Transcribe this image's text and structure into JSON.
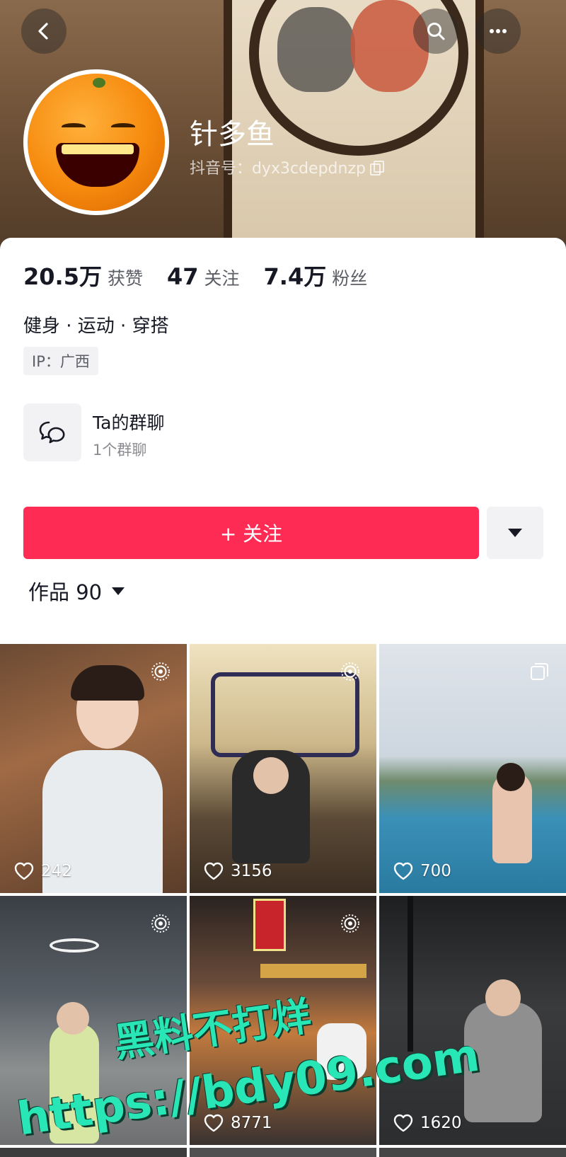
{
  "profile": {
    "name": "针多鱼",
    "douyin_id": "抖音号：dyx3cdepdnzp"
  },
  "stats": [
    {
      "value": "20.5万",
      "label": "获赞"
    },
    {
      "value": "47",
      "label": "关注"
    },
    {
      "value": "7.4万",
      "label": "粉丝"
    }
  ],
  "bio": "健身 · 运动 · 穿搭",
  "ip_location": "IP：广西",
  "group_chat": {
    "title": "Ta的群聊",
    "subtitle": "1个群聊"
  },
  "actions": {
    "follow_label": "+ 关注"
  },
  "works_tab": {
    "label": "作品 90"
  },
  "videos": [
    {
      "likes": "242"
    },
    {
      "likes": "3156"
    },
    {
      "likes": "700"
    },
    {
      "likes": ""
    },
    {
      "likes": "8771"
    },
    {
      "likes": "1620"
    }
  ],
  "watermark": {
    "line1": "黑料不打烊",
    "line2": "https://bdy09.com"
  },
  "colors": {
    "accent": "#fe2c55",
    "watermark": "#29e6b6"
  },
  "icons": {
    "back": "chevron-left-icon",
    "search": "search-icon",
    "more": "more-dots-icon",
    "group": "chat-bubbles-icon",
    "likes": "heart-icon",
    "live_photo": "live-photo-icon",
    "multi_image": "multi-image-icon"
  }
}
